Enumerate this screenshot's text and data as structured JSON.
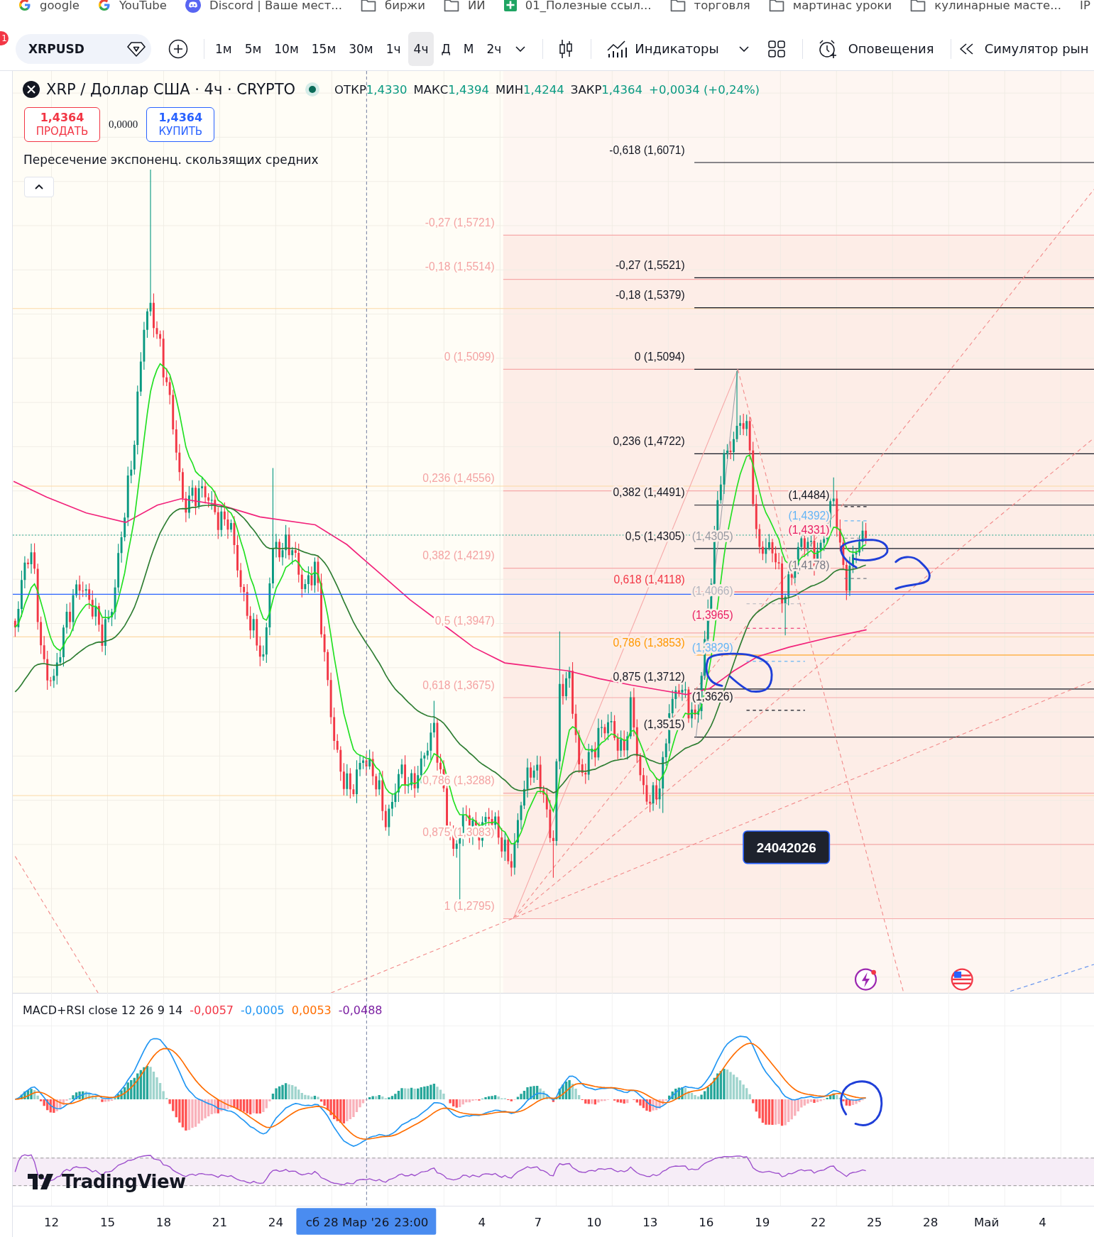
{
  "bookmarks_bar": {
    "items": [
      {
        "label": "google",
        "kind": "google"
      },
      {
        "label": "YouTube",
        "kind": "google"
      },
      {
        "label": "Discord | Ваше мест...",
        "kind": "discord"
      },
      {
        "label": "биржи",
        "kind": "folder"
      },
      {
        "label": "ИИ",
        "kind": "folder"
      },
      {
        "label": "01_Полезные ссыл...",
        "kind": "sheet"
      },
      {
        "label": "торговля",
        "kind": "folder"
      },
      {
        "label": "мартинас уроки",
        "kind": "folder"
      },
      {
        "label": "кулинарные масте...",
        "kind": "folder"
      },
      {
        "label": "IP",
        "kind": "plain"
      }
    ]
  },
  "toolbar": {
    "notification_count": "1",
    "symbol": "XRPUSD",
    "intervals": [
      {
        "label": "1м",
        "selected": false
      },
      {
        "label": "5м",
        "selected": false
      },
      {
        "label": "10м",
        "selected": false
      },
      {
        "label": "15м",
        "selected": false
      },
      {
        "label": "30м",
        "selected": false
      },
      {
        "label": "1ч",
        "selected": false
      },
      {
        "label": "4ч",
        "selected": true
      },
      {
        "label": "Д",
        "selected": false
      },
      {
        "label": "М",
        "selected": false
      },
      {
        "label": "2ч",
        "selected": false
      }
    ],
    "indicators_label": "Индикаторы",
    "alerts_label": "Оповещения",
    "replay_label": "Симулятор рын"
  },
  "chart": {
    "legend": {
      "title": "XRP / Доллар США · 4ч · CRYPTO",
      "ohlc": [
        {
          "label": "ОТКР",
          "value": "1,4330"
        },
        {
          "label": "МАКС",
          "value": "1,4394"
        },
        {
          "label": "МИН",
          "value": "1,4244"
        },
        {
          "label": "ЗАКР",
          "value": "1,4364"
        }
      ],
      "change": "+0,0034 (+0,24%)"
    },
    "trade_panel": {
      "sell_price": "1,4364",
      "sell_label": "ПРОДАТЬ",
      "spread": "0,0000",
      "buy_price": "1,4364",
      "buy_label": "КУПИТЬ"
    },
    "indicator_title": "Пересечение экспоненц. скользящих средних",
    "fib_left": {
      "levels": [
        "-0,27 (1,5721)",
        "-0,18 (1,5514)",
        "0 (1,5099)",
        "0,236 (1,4556)",
        "0,382 (1,4219)",
        "0,5 (1,3947)",
        "0,618 (1,3675)",
        "0,786 (1,3288)",
        "0,875 (1,3083)",
        "1 (1,2795)"
      ]
    },
    "fib_right": {
      "levels": [
        {
          "label": "-0,618 (1,6071)",
          "color": "#131722"
        },
        {
          "label": "-0,27 (1,5521)",
          "color": "#131722"
        },
        {
          "label": "-0,18 (1,5379)",
          "color": "#131722"
        },
        {
          "label": "0 (1,5094)",
          "color": "#131722"
        },
        {
          "label": "0,236 (1,4722)",
          "color": "#131722"
        },
        {
          "label": "0,382 (1,4491)",
          "color": "#131722"
        },
        {
          "label": "0,5 (1,4305)",
          "color": "#131722"
        },
        {
          "label": "0,618 (1,4118)",
          "color": "#f23645"
        },
        {
          "label": "0,786 (1,3853)",
          "color": "#ff9800"
        },
        {
          "label": "0,875 (1,3712)",
          "color": "#131722"
        },
        {
          "label": "(1,3515)",
          "color": "#131722"
        }
      ]
    },
    "fib_small": {
      "labels": [
        {
          "label": "(1,4484)",
          "color": "#131722"
        },
        {
          "label": "(1,4392)",
          "color": "#64b5f6"
        },
        {
          "label": "(1,4331)",
          "color": "#e91e63"
        },
        {
          "label": "(1,4305)",
          "color": "#9598a1"
        },
        {
          "label": "(1,4178)",
          "color": "#787b86"
        },
        {
          "label": "(1,4066)",
          "color": "#b2b5be"
        },
        {
          "label": "(1,3965)",
          "color": "#e91e63"
        },
        {
          "label": "(1,3829)",
          "color": "#64b5f6"
        },
        {
          "label": "(1,3626)",
          "color": "#131722"
        }
      ]
    },
    "note": "24042026"
  },
  "macd_pane": {
    "title": "MACD+RSI close 12 26 9 14",
    "values": [
      {
        "text": "-0,0057",
        "color": "#f23645"
      },
      {
        "text": "-0,0005",
        "color": "#2196f3"
      },
      {
        "text": "0,0053",
        "color": "#ff6d00"
      },
      {
        "text": "-0,0488",
        "color": "#7b1fa2"
      }
    ],
    "brand": "TradingView"
  },
  "time_axis": {
    "labels": [
      "12",
      "15",
      "18",
      "21",
      "24",
      "4",
      "7",
      "10",
      "13",
      "16",
      "19",
      "22",
      "25",
      "28",
      "Май",
      "4"
    ],
    "crosshair": {
      "date": "сб 28 Мар '26",
      "time": "23:00"
    }
  }
}
